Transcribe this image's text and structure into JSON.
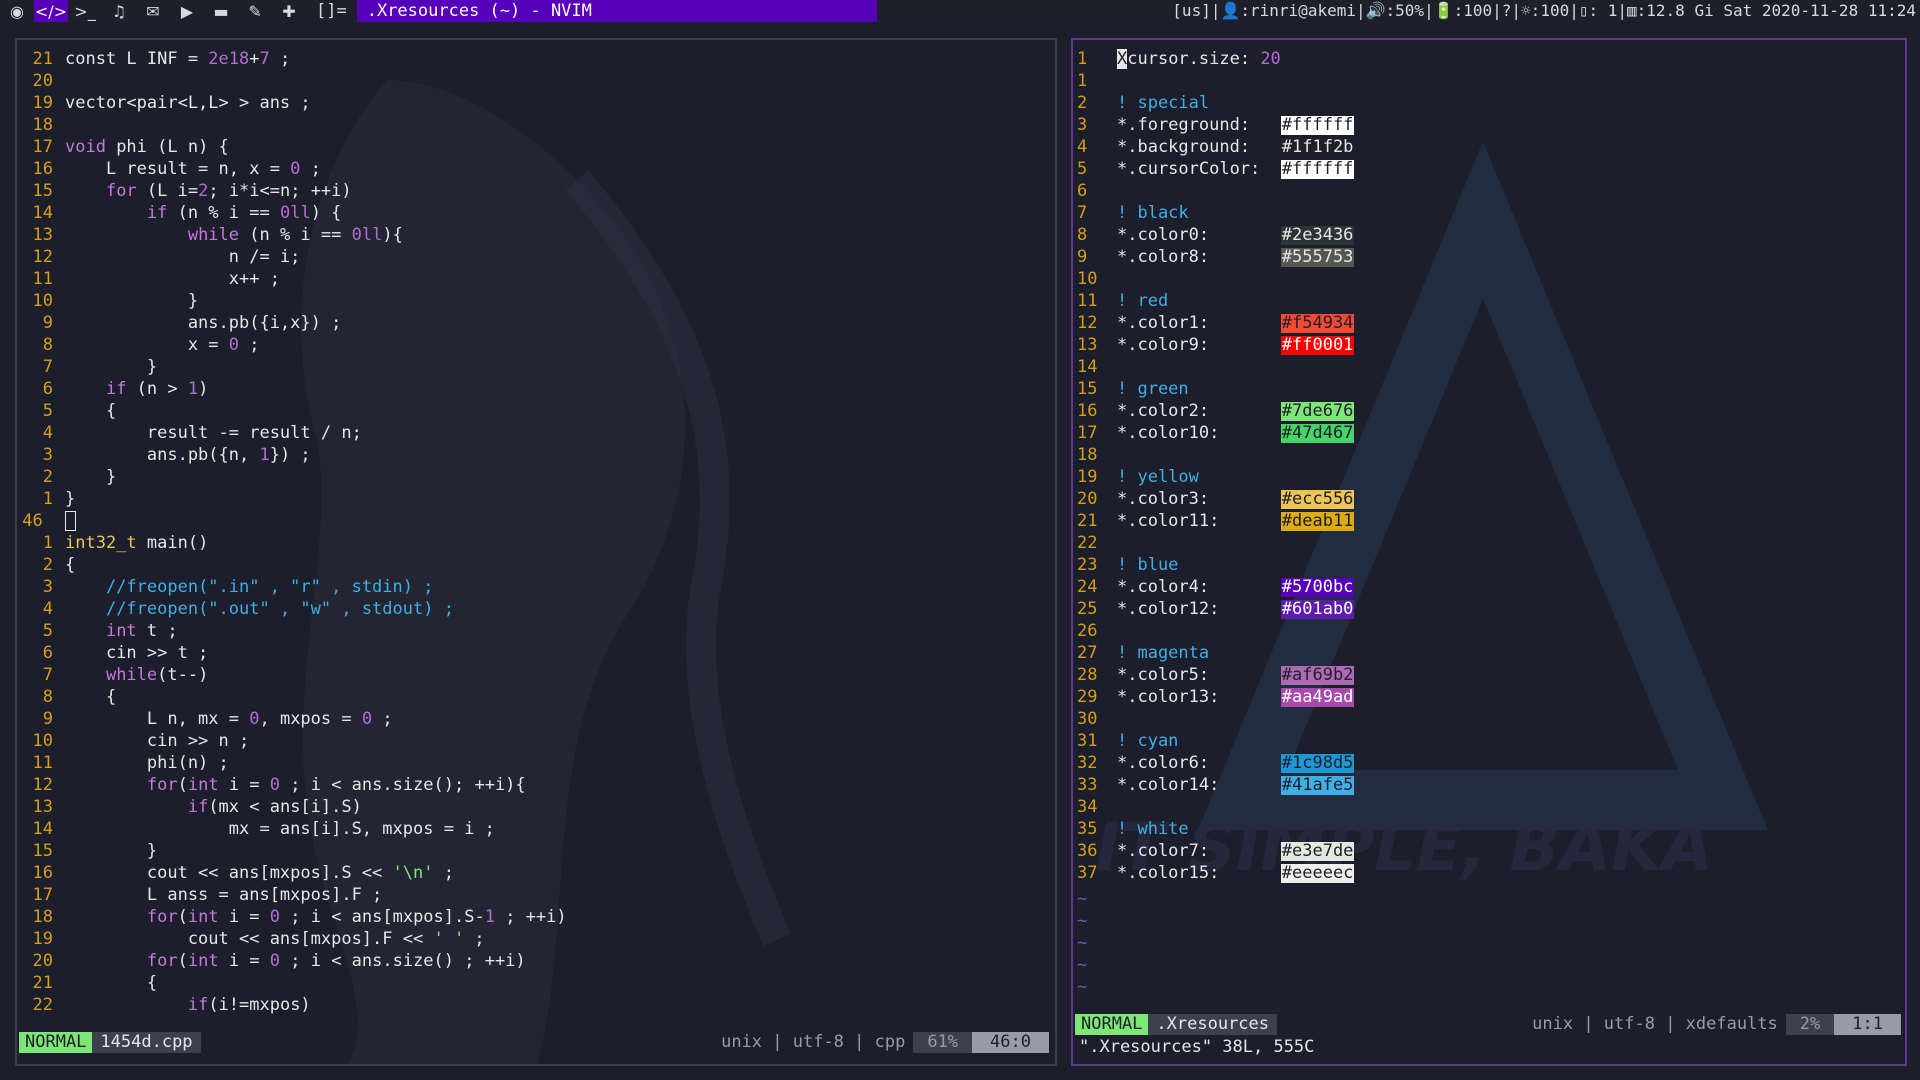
{
  "topbar": {
    "workspaces": [
      {
        "icon": "terminal-icon",
        "glyph": ">_"
      },
      {
        "icon": "music-icon",
        "glyph": "♫"
      },
      {
        "icon": "mail-icon",
        "glyph": "✉"
      },
      {
        "icon": "play-icon",
        "glyph": "▶"
      },
      {
        "icon": "folder-icon",
        "glyph": "▬"
      },
      {
        "icon": "brush-icon",
        "glyph": "✎"
      },
      {
        "icon": "plus-icon",
        "glyph": "✚"
      }
    ],
    "active_workspace": {
      "icon": "code-icon",
      "glyph": "</>"
    },
    "layout": "[]=",
    "window_title": ".Xresources (~) - NVIM",
    "status": "[us]|👤:rinri@akemi|🔊:50%|🔋:100|?|☼:100|▯: 1|▥:12.8 Gi Sat 2020-11-28 11:24"
  },
  "left_editor": {
    "lines": [
      {
        "n": "21",
        "html": "const L INF = <span class='num-lit'>2e18</span>+<span class='num-lit'>7</span> ;"
      },
      {
        "n": "20",
        "html": ""
      },
      {
        "n": "19",
        "html": "vector&lt;pair&lt;L,L&gt; &gt; ans ;"
      },
      {
        "n": "18",
        "html": ""
      },
      {
        "n": "17",
        "html": "<span class='kw'>void</span> phi (L n) {"
      },
      {
        "n": "16",
        "html": "    L result = n, x = <span class='num-lit'>0</span> ;"
      },
      {
        "n": "15",
        "html": "    <span class='kw'>for</span> (L i=<span class='num-lit'>2</span>; i*i&lt;=n; ++i)"
      },
      {
        "n": "14",
        "html": "        <span class='kw'>if</span> (n % i == <span class='num-lit'>0ll</span>) {"
      },
      {
        "n": "13",
        "html": "            <span class='kw'>while</span> (n % i == <span class='num-lit'>0ll</span>){"
      },
      {
        "n": "12",
        "html": "                n /= i;"
      },
      {
        "n": "11",
        "html": "                x++ ;"
      },
      {
        "n": "10",
        "html": "            }"
      },
      {
        "n": "9",
        "html": "            ans.pb({i,x}) ;"
      },
      {
        "n": "8",
        "html": "            x = <span class='num-lit'>0</span> ;"
      },
      {
        "n": "7",
        "html": "        }"
      },
      {
        "n": "6",
        "html": "    <span class='kw'>if</span> (n &gt; <span class='num-lit'>1</span>)"
      },
      {
        "n": "5",
        "html": "    {"
      },
      {
        "n": "4",
        "html": "        result -= result / n;"
      },
      {
        "n": "3",
        "html": "        ans.pb({n, <span class='num-lit'>1</span>}) ;"
      },
      {
        "n": "2",
        "html": "    }"
      },
      {
        "n": "1",
        "html": "}"
      },
      {
        "n": "46 ",
        "html": "<span style='display:inline-block;width:9px;height:18px;border:1px solid #e6e6e6;vertical-align:middle;'></span>",
        "cur": true
      },
      {
        "n": "1",
        "html": "<span class='ty'>int32_t</span> main()"
      },
      {
        "n": "2",
        "html": "{"
      },
      {
        "n": "3",
        "html": "    <span class='cm'>//freopen(\".in\" , \"r\" , stdin) ;</span>"
      },
      {
        "n": "4",
        "html": "    <span class='cm'>//freopen(\".out\" , \"w\" , stdout) ;</span>"
      },
      {
        "n": "5",
        "html": "    <span class='kw'>int</span> t ;"
      },
      {
        "n": "6",
        "html": "    cin &gt;&gt; t ;"
      },
      {
        "n": "7",
        "html": "    <span class='kw'>while</span>(t--)"
      },
      {
        "n": "8",
        "html": "    {"
      },
      {
        "n": "9",
        "html": "        L n, mx = <span class='num-lit'>0</span>, mxpos = <span class='num-lit'>0</span> ;"
      },
      {
        "n": "10",
        "html": "        cin &gt;&gt; n ;"
      },
      {
        "n": "11",
        "html": "        phi(n) ;"
      },
      {
        "n": "12",
        "html": "        <span class='kw'>for</span>(<span class='kw'>int</span> i = <span class='num-lit'>0</span> ; i &lt; ans.size(); ++i){"
      },
      {
        "n": "13",
        "html": "            <span class='kw'>if</span>(mx &lt; ans[i].S)"
      },
      {
        "n": "14",
        "html": "                mx = ans[i].S, mxpos = i ;"
      },
      {
        "n": "15",
        "html": "        }"
      },
      {
        "n": "16",
        "html": "        cout &lt;&lt; ans[mxpos].S &lt;&lt; <span class='str'>'\\n'</span> ;"
      },
      {
        "n": "17",
        "html": "        L anss = ans[mxpos].F ;"
      },
      {
        "n": "18",
        "html": "        <span class='kw'>for</span>(<span class='kw'>int</span> i = <span class='num-lit'>0</span> ; i &lt; ans[mxpos].S-<span class='num-lit'>1</span> ; ++i)"
      },
      {
        "n": "19",
        "html": "            cout &lt;&lt; ans[mxpos].F &lt;&lt; <span class='str'>' '</span> ;"
      },
      {
        "n": "20",
        "html": "        <span class='kw'>for</span>(<span class='kw'>int</span> i = <span class='num-lit'>0</span> ; i &lt; ans.size() ; ++i)"
      },
      {
        "n": "21",
        "html": "        {"
      },
      {
        "n": "22",
        "html": "            <span class='kw'>if</span>(i!=mxpos)"
      }
    ],
    "status": {
      "mode": "NORMAL",
      "file": "1454d.cpp",
      "info": "unix | utf-8 | cpp",
      "percent": "61%",
      "position": "46:0"
    }
  },
  "right_editor": {
    "lines": [
      {
        "n": "1",
        "html": "<span style='background:#e6e6e6;color:#1f1f2b;'>X</span>cursor.size: <span class='num-lit'>20</span>"
      },
      {
        "n": "1",
        "html": ""
      },
      {
        "n": "2",
        "html": "<span class='cm'>! special</span>"
      },
      {
        "n": "3",
        "html": "*.foreground:   <span class='swatch' style='background:#ffffff;color:#1f1f2b;'>#ffffff</span>"
      },
      {
        "n": "4",
        "html": "*.background:   <span class='swatch' style='background:#1f1f2b;color:#e6e6e6;'>#1f1f2b</span>"
      },
      {
        "n": "5",
        "html": "*.cursorColor:  <span class='swatch' style='background:#ffffff;color:#1f1f2b;'>#ffffff</span>"
      },
      {
        "n": "6",
        "html": ""
      },
      {
        "n": "7",
        "html": "<span class='cm'>! black</span>"
      },
      {
        "n": "8",
        "html": "*.color0:       <span class='swatch' style='background:#2e3436;color:#e6e6e6;'>#2e3436</span>"
      },
      {
        "n": "9",
        "html": "*.color8:       <span class='swatch' style='background:#555753;color:#e6e6e6;'>#555753</span>"
      },
      {
        "n": "10",
        "html": ""
      },
      {
        "n": "11",
        "html": "<span class='cm'>! red</span>"
      },
      {
        "n": "12",
        "html": "*.color1:       <span class='swatch' style='background:#f54934;color:#1f1f2b;'>#f54934</span>"
      },
      {
        "n": "13",
        "html": "*.color9:       <span class='swatch' style='background:#ff0001;color:#ffffff;'>#ff0001</span>"
      },
      {
        "n": "14",
        "html": ""
      },
      {
        "n": "15",
        "html": "<span class='cm'>! green</span>"
      },
      {
        "n": "16",
        "html": "*.color2:       <span class='swatch' style='background:#7de676;color:#1f1f2b;'>#7de676</span>"
      },
      {
        "n": "17",
        "html": "*.color10:      <span class='swatch' style='background:#47d467;color:#1f1f2b;'>#47d467</span>"
      },
      {
        "n": "18",
        "html": ""
      },
      {
        "n": "19",
        "html": "<span class='cm'>! yellow</span>"
      },
      {
        "n": "20",
        "html": "*.color3:       <span class='swatch' style='background:#ecc556;color:#1f1f2b;'>#ecc556</span>"
      },
      {
        "n": "21",
        "html": "*.color11:      <span class='swatch' style='background:#deab11;color:#1f1f2b;'>#deab11</span>"
      },
      {
        "n": "22",
        "html": ""
      },
      {
        "n": "23",
        "html": "<span class='cm'>! blue</span>"
      },
      {
        "n": "24",
        "html": "*.color4:       <span class='swatch' style='background:#5700bc;color:#ffffff;'>#5700bc</span>"
      },
      {
        "n": "25",
        "html": "*.color12:      <span class='swatch' style='background:#601ab0;color:#ffffff;'>#601ab0</span>"
      },
      {
        "n": "26",
        "html": ""
      },
      {
        "n": "27",
        "html": "<span class='cm'>! magenta</span>"
      },
      {
        "n": "28",
        "html": "*.color5:       <span class='swatch' style='background:#af69b2;color:#1f1f2b;'>#af69b2</span>"
      },
      {
        "n": "29",
        "html": "*.color13:      <span class='swatch' style='background:#aa49ad;color:#ffffff;'>#aa49ad</span>"
      },
      {
        "n": "30",
        "html": ""
      },
      {
        "n": "31",
        "html": "<span class='cm'>! cyan</span>"
      },
      {
        "n": "32",
        "html": "*.color6:       <span class='swatch' style='background:#1c98d5;color:#1f1f2b;'>#1c98d5</span>"
      },
      {
        "n": "33",
        "html": "*.color14:      <span class='swatch' style='background:#41afe5;color:#1f1f2b;'>#41afe5</span>"
      },
      {
        "n": "34",
        "html": ""
      },
      {
        "n": "35",
        "html": "<span class='cm'>! white</span>"
      },
      {
        "n": "36",
        "html": "*.color7:       <span class='swatch' style='background:#e3e7de;color:#1f1f2b;'>#e3e7de</span>"
      },
      {
        "n": "37",
        "html": "*.color15:      <span class='swatch' style='background:#eeeeec;color:#1f1f2b;'>#eeeeec</span>"
      }
    ],
    "tilde_count": 5,
    "tilde": "~",
    "status": {
      "mode": "NORMAL",
      "file": ".Xresources",
      "info": "unix | utf-8 | xdefaults",
      "percent": "2%",
      "position": "1:1"
    },
    "message": "\".Xresources\" 38L, 555C"
  },
  "wallpaper_text": "KEEP IT SIMPLE, BAKA"
}
